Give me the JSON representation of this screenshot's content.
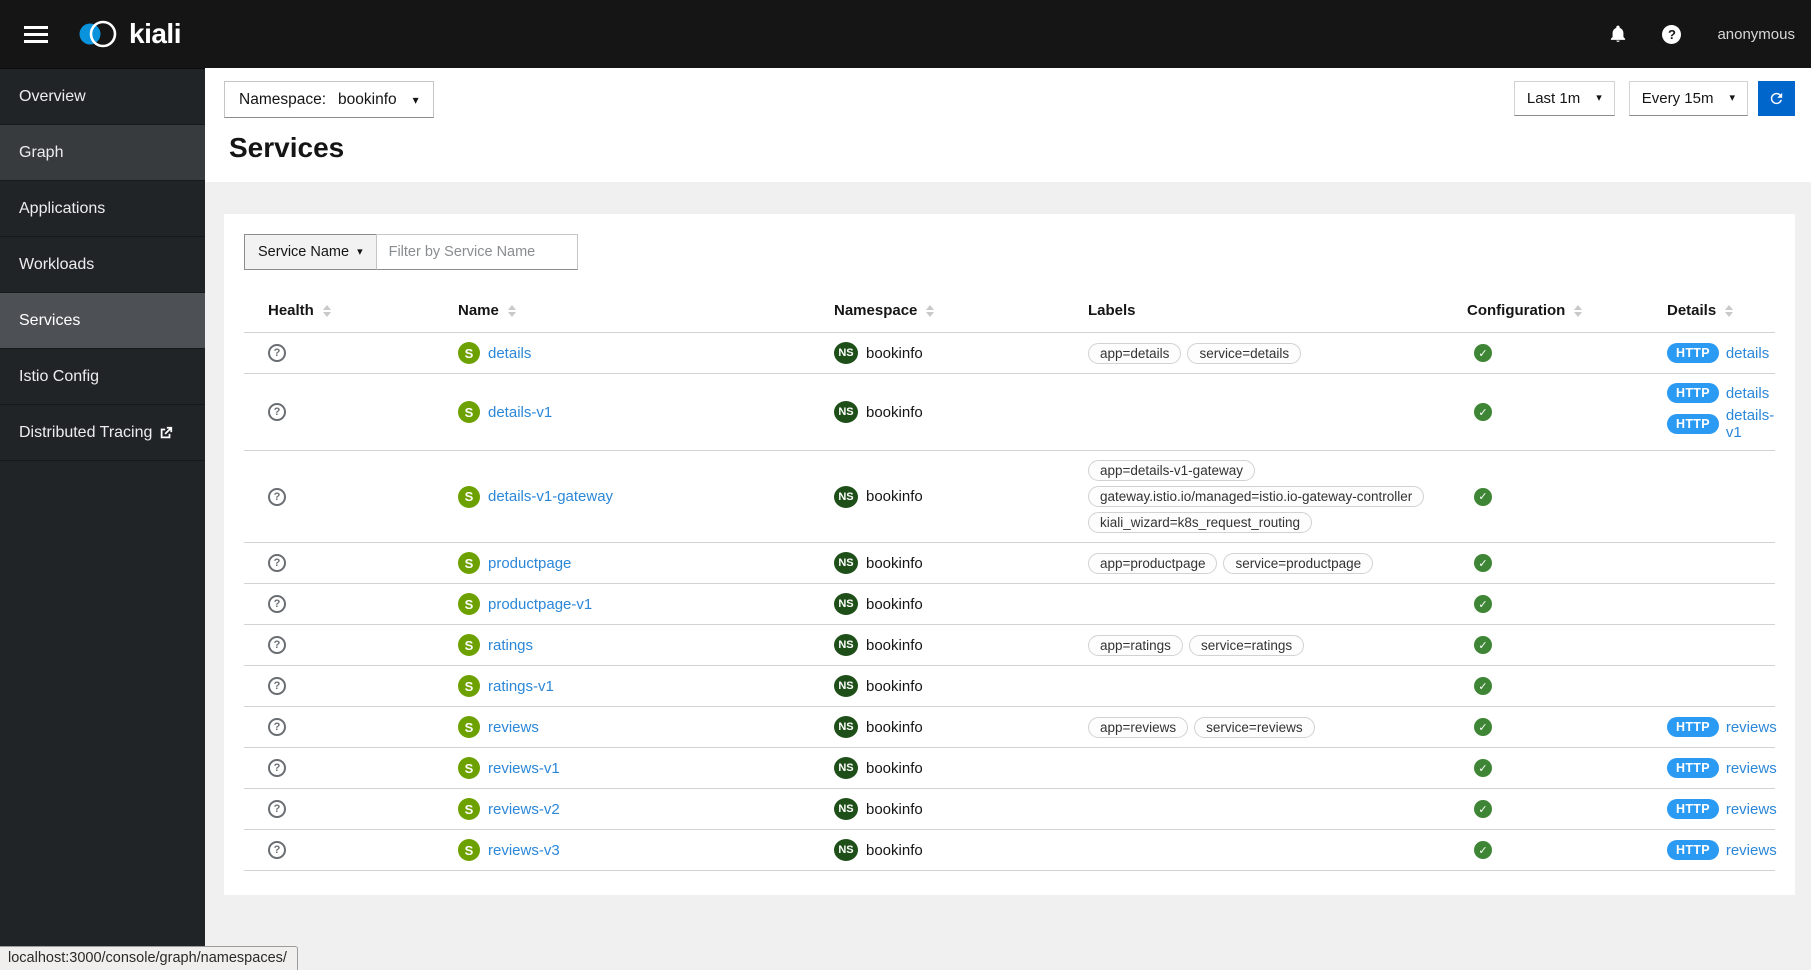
{
  "masthead": {
    "brand": "kiali",
    "user": "anonymous"
  },
  "sidebar": {
    "items": [
      {
        "label": "Overview",
        "state": "normal",
        "external": false
      },
      {
        "label": "Graph",
        "state": "hover",
        "external": false
      },
      {
        "label": "Applications",
        "state": "normal",
        "external": false
      },
      {
        "label": "Workloads",
        "state": "normal",
        "external": false
      },
      {
        "label": "Services",
        "state": "active",
        "external": false
      },
      {
        "label": "Istio Config",
        "state": "normal",
        "external": false
      },
      {
        "label": "Distributed Tracing",
        "state": "normal",
        "external": true
      }
    ]
  },
  "toolbar": {
    "namespace_label": "Namespace:",
    "namespace_value": "bookinfo",
    "duration_value": "Last 1m",
    "refresh_value": "Every 15m"
  },
  "page": {
    "title": "Services"
  },
  "filter": {
    "type_button": "Service Name",
    "placeholder": "Filter by Service Name"
  },
  "table": {
    "columns": [
      {
        "label": "Health",
        "sortable": true
      },
      {
        "label": "Name",
        "sortable": true
      },
      {
        "label": "Namespace",
        "sortable": true
      },
      {
        "label": "Labels",
        "sortable": false
      },
      {
        "label": "Configuration",
        "sortable": true
      },
      {
        "label": "Details",
        "sortable": true
      }
    ],
    "rows": [
      {
        "health": "unknown",
        "name": "details",
        "namespace": "bookinfo",
        "labels": [
          "app=details",
          "service=details"
        ],
        "config_ok": true,
        "details": [
          {
            "badge": "HTTP",
            "link": "details"
          }
        ]
      },
      {
        "health": "unknown",
        "name": "details-v1",
        "namespace": "bookinfo",
        "labels": [],
        "config_ok": true,
        "details": [
          {
            "badge": "HTTP",
            "link": "details"
          },
          {
            "badge": "HTTP",
            "link": "details-v1"
          }
        ]
      },
      {
        "health": "unknown",
        "name": "details-v1-gateway",
        "namespace": "bookinfo",
        "labels": [
          "app=details-v1-gateway",
          "gateway.istio.io/managed=istio.io-gateway-controller",
          "kiali_wizard=k8s_request_routing"
        ],
        "config_ok": true,
        "details": []
      },
      {
        "health": "unknown",
        "name": "productpage",
        "namespace": "bookinfo",
        "labels": [
          "app=productpage",
          "service=productpage"
        ],
        "config_ok": true,
        "details": []
      },
      {
        "health": "unknown",
        "name": "productpage-v1",
        "namespace": "bookinfo",
        "labels": [],
        "config_ok": true,
        "details": []
      },
      {
        "health": "unknown",
        "name": "ratings",
        "namespace": "bookinfo",
        "labels": [
          "app=ratings",
          "service=ratings"
        ],
        "config_ok": true,
        "details": []
      },
      {
        "health": "unknown",
        "name": "ratings-v1",
        "namespace": "bookinfo",
        "labels": [],
        "config_ok": true,
        "details": []
      },
      {
        "health": "unknown",
        "name": "reviews",
        "namespace": "bookinfo",
        "labels": [
          "app=reviews",
          "service=reviews"
        ],
        "config_ok": true,
        "details": [
          {
            "badge": "HTTP",
            "link": "reviews"
          }
        ]
      },
      {
        "health": "unknown",
        "name": "reviews-v1",
        "namespace": "bookinfo",
        "labels": [],
        "config_ok": true,
        "details": [
          {
            "badge": "HTTP",
            "link": "reviews"
          }
        ]
      },
      {
        "health": "unknown",
        "name": "reviews-v2",
        "namespace": "bookinfo",
        "labels": [],
        "config_ok": true,
        "details": [
          {
            "badge": "HTTP",
            "link": "reviews"
          }
        ]
      },
      {
        "health": "unknown",
        "name": "reviews-v3",
        "namespace": "bookinfo",
        "labels": [],
        "config_ok": true,
        "details": [
          {
            "badge": "HTTP",
            "link": "reviews"
          }
        ]
      }
    ]
  },
  "status_bar": {
    "text": "localhost:3000/console/graph/namespaces/"
  },
  "badges": {
    "namespace_abbr": "NS",
    "service_abbr": "S"
  },
  "colors": {
    "masthead_bg": "#151515",
    "sidebar_bg": "#212427",
    "sidebar_active_bg": "#4d5156",
    "accent_blue": "#0066cc",
    "badge_blue": "#2b9af3",
    "link_blue": "#2b87d8",
    "success_green": "#3e8635",
    "service_green": "#6ca100",
    "namespace_green": "#1e4f18",
    "page_bg": "#f0f0f0"
  }
}
